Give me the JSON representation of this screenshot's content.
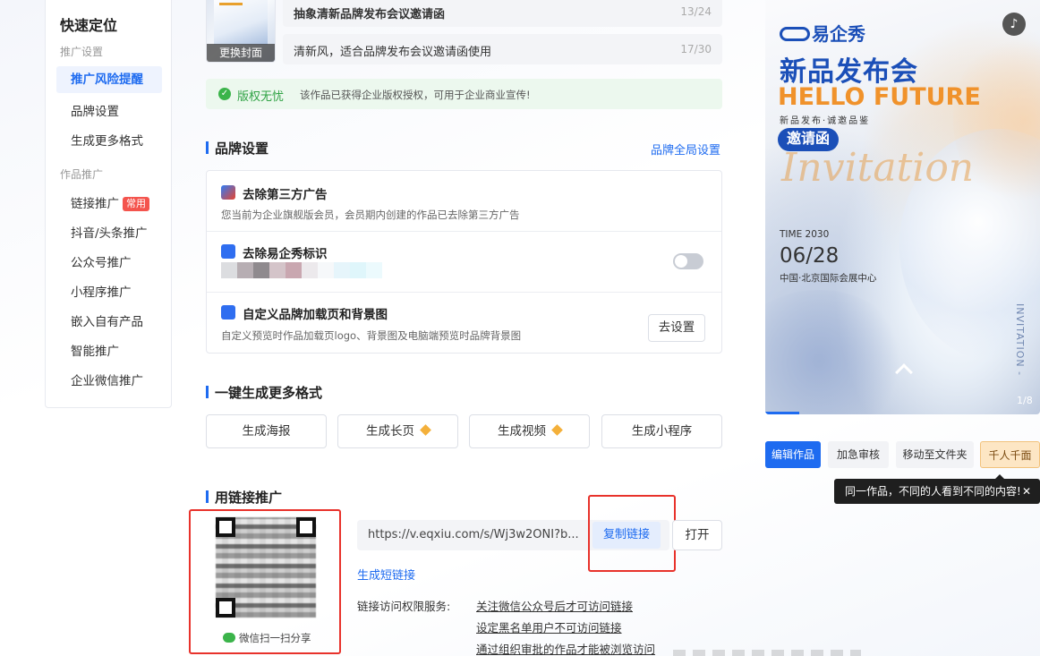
{
  "sidebar": {
    "title": "快速定位",
    "group1": "推广设置",
    "items1": [
      "推广风险提醒",
      "品牌设置",
      "生成更多格式"
    ],
    "group2": "作品推广",
    "items2": [
      "链接推广",
      "抖音/头条推广",
      "公众号推广",
      "小程序推广",
      "嵌入自有产品",
      "智能推广",
      "企业微信推广"
    ],
    "badge_common": "常用"
  },
  "cover": {
    "change_label": "更换封面"
  },
  "fields": {
    "title_value": "抽象清新品牌发布会议邀请函",
    "title_count": "13/24",
    "desc_value": "清新风，适合品牌发布会议邀请函使用",
    "desc_count": "17/30"
  },
  "copyright": {
    "label": "版权无忧",
    "desc": "该作品已获得企业版权授权，可用于企业商业宣传!"
  },
  "brand": {
    "section_title": "品牌设置",
    "global_link": "品牌全局设置",
    "row1_title": "去除第三方广告",
    "row1_desc": "您当前为企业旗舰版会员，会员期内创建的作品已去除第三方广告",
    "row2_title": "去除易企秀标识",
    "row3_title": "自定义品牌加载页和背景图",
    "row3_desc": "自定义预览时作品加载页logo、背景图及电脑端预览时品牌背景图",
    "row3_button": "去设置"
  },
  "formats": {
    "section_title": "一键生成更多格式",
    "buttons": [
      "生成海报",
      "生成长页",
      "生成视频",
      "生成小程序"
    ]
  },
  "link_promo": {
    "section_title": "用链接推广",
    "url": "https://v.eqxiu.com/s/Wj3w2ONI?b...",
    "copy_button": "复制链接",
    "open_button": "打开",
    "short_link": "生成短链接",
    "qr_caption": "微信扫一扫分享",
    "perm_label": "链接访问权限服务:",
    "perm_items": [
      "关注微信公众号后才可访问链接",
      "设定黑名单用户不可访问链接",
      "通过组织审批的作品才能被浏览访问"
    ]
  },
  "preview": {
    "logo_text": "易企秀",
    "title": "新品发布会",
    "hello": "HELLO FUTURE",
    "sub": "新品发布·诚邀品鉴",
    "invite": "邀请函",
    "script": "Invitation",
    "time_label": "TIME  2030",
    "date": "06/28",
    "place": "中国·北京国际会展中心",
    "vertical": "INVITATION -",
    "page": "1/8",
    "music_icon": "♪"
  },
  "actions": {
    "edit": "编辑作品",
    "urgent": "加急审核",
    "move": "移动至文件夹",
    "personalize": "千人千面",
    "tip": "同一作品，不同的人看到不同的内容!",
    "tip_close": "✕"
  },
  "colors": {
    "accent": "#1e6bf0",
    "highlight_red": "#e8322b",
    "badge_red": "#f4544d",
    "success_green": "#3bb44a"
  }
}
